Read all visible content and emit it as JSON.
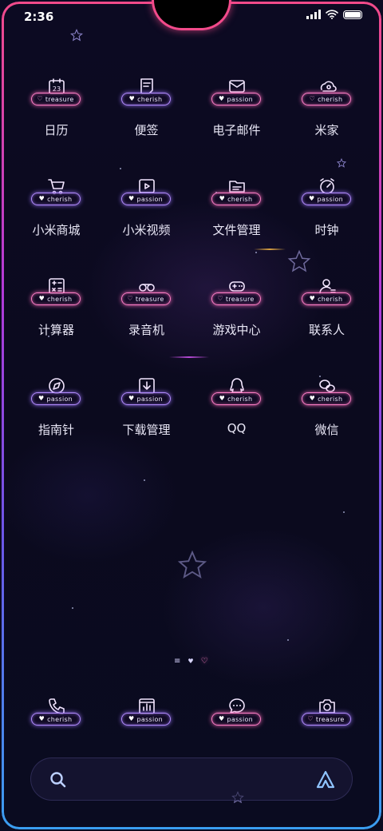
{
  "status_bar": {
    "time": "2:36",
    "icons": [
      "signal-icon",
      "wifi-icon",
      "battery-icon"
    ]
  },
  "colors": {
    "frame_top": "#f24a8a",
    "frame_mid": "#b23ad8",
    "frame_bottom": "#3a9ef0",
    "pill_pink": "#ff7fc7",
    "pill_violet": "#b48cff",
    "background": "#0b0a1f"
  },
  "apps": [
    {
      "label": "日历",
      "tag": "treasure",
      "heart": "outline",
      "pill": "pink",
      "icon": "calendar-icon",
      "day": "23"
    },
    {
      "label": "便签",
      "tag": "cherish",
      "heart": "filled",
      "pill": "violet",
      "icon": "notes-icon"
    },
    {
      "label": "电子邮件",
      "tag": "passion",
      "heart": "filled",
      "pill": "pink",
      "icon": "mail-icon"
    },
    {
      "label": "米家",
      "tag": "cherish",
      "heart": "outline",
      "pill": "pink",
      "icon": "smart-home-icon"
    },
    {
      "label": "小米商城",
      "tag": "cherish",
      "heart": "filled",
      "pill": "violet",
      "icon": "shopping-cart-icon"
    },
    {
      "label": "小米视频",
      "tag": "passion",
      "heart": "filled",
      "pill": "violet",
      "icon": "video-icon"
    },
    {
      "label": "文件管理",
      "tag": "cherish",
      "heart": "filled",
      "pill": "pink",
      "icon": "folder-icon"
    },
    {
      "label": "时钟",
      "tag": "passion",
      "heart": "filled",
      "pill": "violet",
      "icon": "clock-icon"
    },
    {
      "label": "计算器",
      "tag": "cherish",
      "heart": "filled",
      "pill": "pink",
      "icon": "calculator-icon"
    },
    {
      "label": "录音机",
      "tag": "treasure",
      "heart": "outline",
      "pill": "pink",
      "icon": "recorder-icon"
    },
    {
      "label": "游戏中心",
      "tag": "treasure",
      "heart": "outline",
      "pill": "pink",
      "icon": "gamepad-icon"
    },
    {
      "label": "联系人",
      "tag": "cherish",
      "heart": "filled",
      "pill": "pink",
      "icon": "contacts-icon"
    },
    {
      "label": "指南针",
      "tag": "passion",
      "heart": "filled",
      "pill": "violet",
      "icon": "compass-icon"
    },
    {
      "label": "下载管理",
      "tag": "passion",
      "heart": "filled",
      "pill": "violet",
      "icon": "download-icon"
    },
    {
      "label": "QQ",
      "tag": "cherish",
      "heart": "filled",
      "pill": "pink",
      "icon": "qq-icon"
    },
    {
      "label": "微信",
      "tag": "cherish",
      "heart": "filled",
      "pill": "pink",
      "icon": "wechat-icon"
    }
  ],
  "page_indicator": [
    "menu-lines-icon",
    "heart-dot-icon",
    "heart-current-icon"
  ],
  "dock": [
    {
      "tag": "cherish",
      "heart": "filled",
      "pill": "violet",
      "icon": "phone-icon"
    },
    {
      "tag": "passion",
      "heart": "filled",
      "pill": "violet",
      "icon": "stats-icon"
    },
    {
      "tag": "passion",
      "heart": "filled",
      "pill": "pink",
      "icon": "messages-icon"
    },
    {
      "tag": "treasure",
      "heart": "outline",
      "pill": "violet",
      "icon": "camera-icon"
    }
  ],
  "search_bar": {
    "left_icon": "search-icon",
    "right_icon": "assistant-icon"
  }
}
